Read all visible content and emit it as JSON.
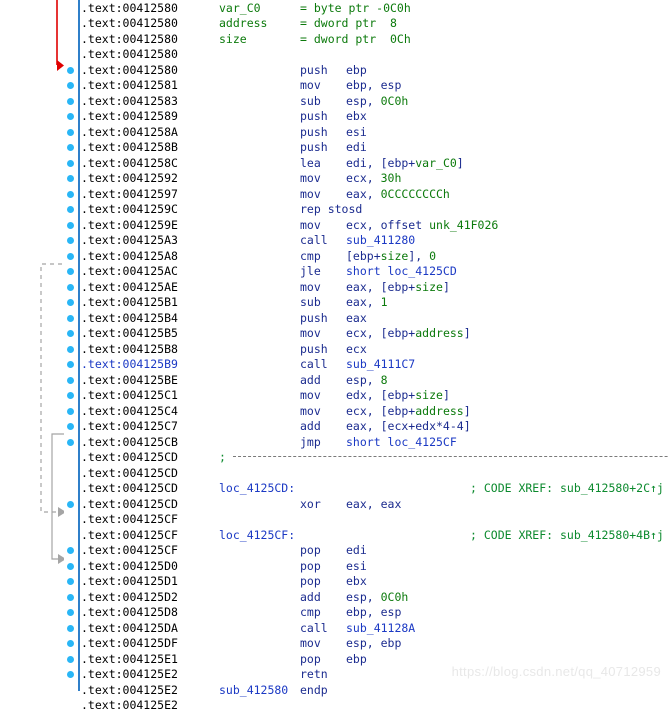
{
  "window": {
    "view": "IDA View-A disassembly listing",
    "segment": ".text",
    "function": "sub_412580"
  },
  "watermark": {
    "text": "https://blog.csdn.net/qq_40712959"
  },
  "colors": {
    "address": "#000000",
    "address_highlight": "#1b39c4",
    "mnemonic": "#1b2b8f",
    "number_or_name": "#0c7a0c",
    "label": "#1b39c4",
    "comment": "#0c8a2e",
    "instruction_dot": "#29b6f6",
    "separator_bar": "#2f7fc9",
    "current_arrow": "#e00000",
    "flow_arrow": "#9a9a9a"
  },
  "listing": {
    "rows": [
      {
        "addr": ".text:00412580",
        "name": "var_C0",
        "eq": "= byte ptr -0C0h",
        "dot": false
      },
      {
        "addr": ".text:00412580",
        "name": "address",
        "eq": "= dword ptr  8",
        "dot": false
      },
      {
        "addr": ".text:00412580",
        "name": "size",
        "eq": "= dword ptr  0Ch",
        "dot": false
      },
      {
        "addr": ".text:00412580",
        "dot": false
      },
      {
        "addr": ".text:00412580",
        "mnem": "push",
        "opnd": "ebp",
        "dot": true,
        "arrow": "current"
      },
      {
        "addr": ".text:00412581",
        "mnem": "mov",
        "opnd": "ebp, esp",
        "dot": true
      },
      {
        "addr": ".text:00412583",
        "mnem": "sub",
        "opnd": "esp, 0C0h",
        "dot": true,
        "nums": [
          "0C0h"
        ]
      },
      {
        "addr": ".text:00412589",
        "mnem": "push",
        "opnd": "ebx",
        "dot": true
      },
      {
        "addr": ".text:0041258A",
        "mnem": "push",
        "opnd": "esi",
        "dot": true
      },
      {
        "addr": ".text:0041258B",
        "mnem": "push",
        "opnd": "edi",
        "dot": true
      },
      {
        "addr": ".text:0041258C",
        "mnem": "lea",
        "opnd": "edi, [ebp+var_C0]",
        "dot": true,
        "nums": [
          "var_C0"
        ]
      },
      {
        "addr": ".text:00412592",
        "mnem": "mov",
        "opnd": "ecx, 30h",
        "dot": true,
        "nums": [
          "30h"
        ]
      },
      {
        "addr": ".text:00412597",
        "mnem": "mov",
        "opnd": "eax, 0CCCCCCCCh",
        "dot": true,
        "nums": [
          "0CCCCCCCCh"
        ]
      },
      {
        "addr": ".text:0041259C",
        "mnem": "rep stosd",
        "opnd": "",
        "dot": true,
        "wide_mnem": true
      },
      {
        "addr": ".text:0041259E",
        "mnem": "mov",
        "opnd": "ecx, offset unk_41F026",
        "dot": true,
        "nums": [
          "unk_41F026"
        ]
      },
      {
        "addr": ".text:004125A3",
        "mnem": "call",
        "opnd": "sub_411280",
        "dot": true,
        "call": true
      },
      {
        "addr": ".text:004125A8",
        "mnem": "cmp",
        "opnd": "[ebp+size], 0",
        "dot": true,
        "nums": [
          "size",
          "0"
        ]
      },
      {
        "addr": ".text:004125AC",
        "mnem": "jle",
        "opnd": "short loc_4125CD",
        "dot": true,
        "call": true
      },
      {
        "addr": ".text:004125AE",
        "mnem": "mov",
        "opnd": "eax, [ebp+size]",
        "dot": true,
        "nums": [
          "size"
        ]
      },
      {
        "addr": ".text:004125B1",
        "mnem": "sub",
        "opnd": "eax, 1",
        "dot": true,
        "nums": [
          "1"
        ]
      },
      {
        "addr": ".text:004125B4",
        "mnem": "push",
        "opnd": "eax",
        "dot": true
      },
      {
        "addr": ".text:004125B5",
        "mnem": "mov",
        "opnd": "ecx, [ebp+address]",
        "dot": true,
        "nums": [
          "address"
        ]
      },
      {
        "addr": ".text:004125B8",
        "mnem": "push",
        "opnd": "ecx",
        "dot": true
      },
      {
        "addr": ".text:004125B9",
        "mnem": "call",
        "opnd": "sub_4111C7",
        "dot": true,
        "call": true,
        "addr_highlight": true
      },
      {
        "addr": ".text:004125BE",
        "mnem": "add",
        "opnd": "esp, 8",
        "dot": true,
        "nums": [
          "8"
        ]
      },
      {
        "addr": ".text:004125C1",
        "mnem": "mov",
        "opnd": "edx, [ebp+size]",
        "dot": true,
        "nums": [
          "size"
        ]
      },
      {
        "addr": ".text:004125C4",
        "mnem": "mov",
        "opnd": "ecx, [ebp+address]",
        "dot": true,
        "nums": [
          "address"
        ]
      },
      {
        "addr": ".text:004125C7",
        "mnem": "add",
        "opnd": "eax, [ecx+edx*4-4]",
        "dot": true
      },
      {
        "addr": ".text:004125CB",
        "mnem": "jmp",
        "opnd": "short loc_4125CF",
        "dot": true,
        "call": true
      },
      {
        "addr": ".text:004125CD",
        "sep": true,
        "dot": false
      },
      {
        "addr": ".text:004125CD",
        "dot": false
      },
      {
        "addr": ".text:004125CD",
        "label": "loc_4125CD:",
        "comment": "; CODE XREF: sub_412580+2C↑j",
        "dot": false
      },
      {
        "addr": ".text:004125CD",
        "mnem": "xor",
        "opnd": "eax, eax",
        "dot": true
      },
      {
        "addr": ".text:004125CF",
        "dot": false
      },
      {
        "addr": ".text:004125CF",
        "label": "loc_4125CF:",
        "comment": "; CODE XREF: sub_412580+4B↑j",
        "dot": false
      },
      {
        "addr": ".text:004125CF",
        "mnem": "pop",
        "opnd": "edi",
        "dot": true
      },
      {
        "addr": ".text:004125D0",
        "mnem": "pop",
        "opnd": "esi",
        "dot": true
      },
      {
        "addr": ".text:004125D1",
        "mnem": "pop",
        "opnd": "ebx",
        "dot": true
      },
      {
        "addr": ".text:004125D2",
        "mnem": "add",
        "opnd": "esp, 0C0h",
        "dot": true,
        "nums": [
          "0C0h"
        ]
      },
      {
        "addr": ".text:004125D8",
        "mnem": "cmp",
        "opnd": "ebp, esp",
        "dot": true
      },
      {
        "addr": ".text:004125DA",
        "mnem": "call",
        "opnd": "sub_41128A",
        "dot": true,
        "call": true
      },
      {
        "addr": ".text:004125DF",
        "mnem": "mov",
        "opnd": "esp, ebp",
        "dot": true
      },
      {
        "addr": ".text:004125E1",
        "mnem": "pop",
        "opnd": "ebp",
        "dot": true
      },
      {
        "addr": ".text:004125E2",
        "mnem": "retn",
        "opnd": "",
        "dot": true
      },
      {
        "addr": ".text:004125E2",
        "name_blue": "sub_412580",
        "mnem": "endp",
        "opnd": "",
        "dot": false
      },
      {
        "addr": ".text:004125E2",
        "dot": false
      }
    ]
  }
}
